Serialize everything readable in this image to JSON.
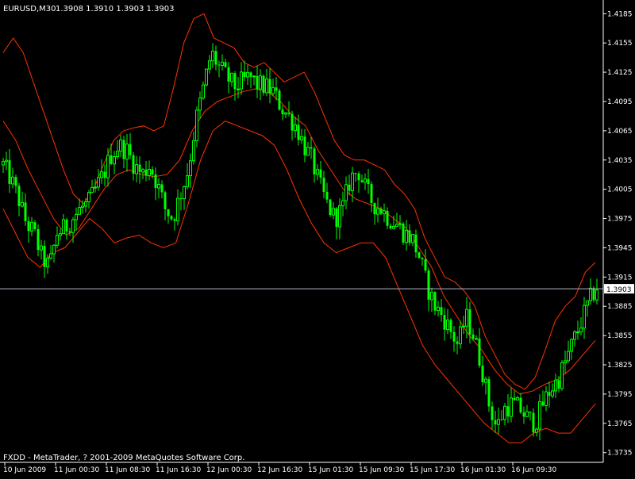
{
  "header": {
    "symbol": "EURUSD,M30",
    "ohlc": "1.3908 1.3910 1.3903 1.3903"
  },
  "footer": {
    "copyright": "FXDD - MetaTrader, ? 2001-2009 MetaQuotes Software Corp."
  },
  "colors": {
    "background": "#000000",
    "axis": "#ffffff",
    "candle": "#00ff00",
    "bands": "#ff3300",
    "price_line": "#b0b8c8",
    "label_bg": "#ffffff",
    "label_text": "#000000"
  },
  "chart_data": {
    "type": "candlestick",
    "ylim": [
      1.3725,
      1.4195
    ],
    "y_ticks": [
      "1.4185",
      "1.4155",
      "1.4125",
      "1.4095",
      "1.4065",
      "1.4035",
      "1.4005",
      "1.3975",
      "1.3945",
      "1.3915",
      "1.3885",
      "1.3855",
      "1.3825",
      "1.3795",
      "1.3765",
      "1.3735"
    ],
    "x_ticks": [
      "10 Jun 2009",
      "11 Jun 00:30",
      "11 Jun 08:30",
      "11 Jun 16:30",
      "12 Jun 00:30",
      "12 Jun 16:30",
      "15 Jun 01:30",
      "15 Jun 09:30",
      "15 Jun 17:30",
      "16 Jun 01:30",
      "16 Jun 09:30"
    ],
    "current_price": 1.3903,
    "current_price_label": "1.3903",
    "close_series": [
      1.403,
      1.4015,
      1.3995,
      1.397,
      1.396,
      1.3935,
      1.3925,
      1.396,
      1.3965,
      1.3975,
      1.3985,
      1.399,
      1.4005,
      1.402,
      1.404,
      1.405,
      1.4045,
      1.403,
      1.402,
      1.403,
      1.401,
      1.3985,
      1.3975,
      1.4,
      1.4025,
      1.4075,
      1.411,
      1.4145,
      1.413,
      1.412,
      1.411,
      1.4115,
      1.412,
      1.4112,
      1.411,
      1.4105,
      1.409,
      1.408,
      1.407,
      1.405,
      1.4035,
      1.401,
      1.399,
      1.3975,
      1.3985,
      1.4015,
      1.4025,
      1.4005,
      1.399,
      1.3985,
      1.3975,
      1.397,
      1.396,
      1.3955,
      1.3935,
      1.3905,
      1.3885,
      1.3875,
      1.386,
      1.3845,
      1.3875,
      1.3855,
      1.3825,
      1.3785,
      1.376,
      1.378,
      1.3785,
      1.378,
      1.377,
      1.3765,
      1.3785,
      1.38,
      1.381,
      1.383,
      1.385,
      1.387,
      1.389,
      1.3905
    ],
    "bands": {
      "upper": [
        1.4145,
        1.416,
        1.4145,
        1.4115,
        1.4085,
        1.4055,
        1.4025,
        1.4,
        1.399,
        1.4005,
        1.403,
        1.4055,
        1.4065,
        1.4068,
        1.407,
        1.4065,
        1.407,
        1.411,
        1.4155,
        1.418,
        1.4185,
        1.416,
        1.4155,
        1.415,
        1.4135,
        1.413,
        1.4135,
        1.4125,
        1.4115,
        1.412,
        1.4125,
        1.4105,
        1.408,
        1.4055,
        1.404,
        1.4035,
        1.4035,
        1.403,
        1.4025,
        1.401,
        1.4,
        1.3985,
        1.3955,
        1.3935,
        1.3915,
        1.391,
        1.39,
        1.3885,
        1.3855,
        1.3835,
        1.3815,
        1.3805,
        1.38,
        1.3812,
        1.384,
        1.387,
        1.3885,
        1.3895,
        1.392,
        1.393
      ],
      "middle": [
        1.4075,
        1.4055,
        1.4025,
        1.4,
        1.3975,
        1.3958,
        1.3965,
        1.3985,
        1.4005,
        1.402,
        1.4025,
        1.402,
        1.4018,
        1.402,
        1.4035,
        1.4065,
        1.4085,
        1.4095,
        1.41,
        1.4105,
        1.4108,
        1.4105,
        1.4095,
        1.408,
        1.407,
        1.4045,
        1.4025,
        1.4005,
        1.3995,
        1.399,
        1.3985,
        1.3975,
        1.3965,
        1.3945,
        1.3925,
        1.3895,
        1.3875,
        1.3855,
        1.384,
        1.382,
        1.3805,
        1.3795,
        1.3798,
        1.3805,
        1.381,
        1.382,
        1.3835,
        1.385
      ],
      "lower": [
        1.3985,
        1.396,
        1.3935,
        1.3925,
        1.394,
        1.3945,
        1.396,
        1.3975,
        1.3965,
        1.395,
        1.3955,
        1.3958,
        1.395,
        1.3945,
        1.395,
        1.399,
        1.4035,
        1.4065,
        1.4075,
        1.407,
        1.4065,
        1.406,
        1.405,
        1.4025,
        1.3995,
        1.397,
        1.395,
        1.394,
        1.3945,
        1.395,
        1.395,
        1.3935,
        1.3905,
        1.3875,
        1.3845,
        1.3825,
        1.381,
        1.3795,
        1.378,
        1.3765,
        1.3755,
        1.3745,
        1.3745,
        1.3755,
        1.376,
        1.3755,
        1.3755,
        1.377,
        1.3785
      ]
    }
  }
}
